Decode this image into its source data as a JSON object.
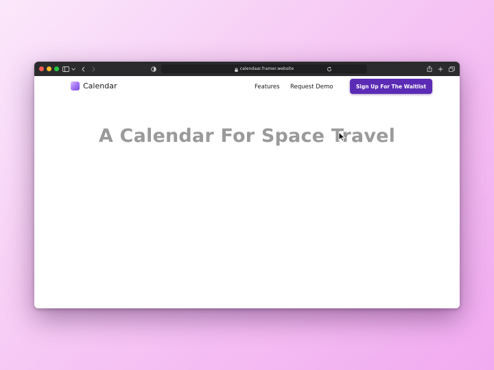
{
  "browser": {
    "url": "calendaar.framer.website"
  },
  "site": {
    "brand": "Calendar",
    "nav": {
      "features": "Features",
      "request_demo": "Request Demo",
      "cta": "Sign Up For The Waitlist"
    },
    "hero_title": "A Calendar For Space Travel"
  },
  "colors": {
    "cta": "#5b2bb5",
    "hero_text": "#9a9a9a",
    "toolbar": "#2b2b2d"
  },
  "icons": [
    "sidebar-icon",
    "chevron-down-icon",
    "back-icon",
    "forward-icon",
    "shield-icon",
    "lock-icon",
    "reload-icon",
    "share-icon",
    "new-tab-icon",
    "tabs-icon",
    "mouse-cursor-icon"
  ]
}
